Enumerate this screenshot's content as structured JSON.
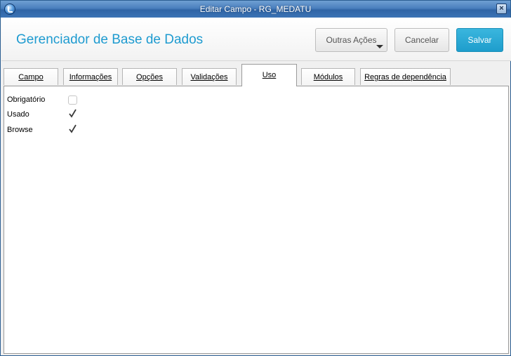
{
  "window": {
    "title": "Editar Campo - RG_MEDATU",
    "close_symbol": "×"
  },
  "header": {
    "app_title": "Gerenciador de Base de Dados",
    "buttons": {
      "more_actions": "Outras Ações",
      "cancel": "Cancelar",
      "save": "Salvar"
    },
    "colors": {
      "title": "#1e9bd0",
      "save_bg": "#1e9dcc"
    }
  },
  "tabs": [
    {
      "label": "Campo",
      "active": false
    },
    {
      "label": "Informações",
      "active": false
    },
    {
      "label": "Opções",
      "active": false
    },
    {
      "label": "Validações",
      "active": false
    },
    {
      "label": "Uso",
      "active": true
    },
    {
      "label": "Módulos",
      "active": false
    },
    {
      "label": "Regras de dependência",
      "active": false
    }
  ],
  "uso": {
    "fields": [
      {
        "label": "Obrigatório",
        "checked": false
      },
      {
        "label": "Usado",
        "checked": true
      },
      {
        "label": "Browse",
        "checked": true
      }
    ]
  }
}
